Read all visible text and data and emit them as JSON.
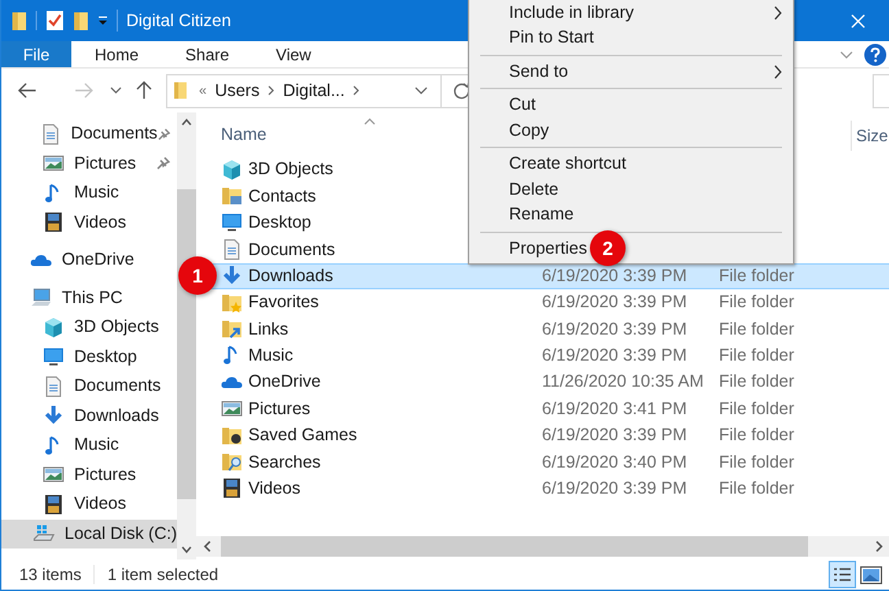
{
  "window": {
    "title": "Digital Citizen"
  },
  "ribbon_tabs": [
    {
      "label": "File",
      "selected": true
    },
    {
      "label": "Home",
      "selected": false
    },
    {
      "label": "Share",
      "selected": false
    },
    {
      "label": "View",
      "selected": false
    }
  ],
  "address_bar": {
    "overflow": "«",
    "segments": [
      "Users",
      "Digital..."
    ]
  },
  "navigation_pane": {
    "quick_access_items": [
      {
        "label": "Documents",
        "kind": "documents",
        "pinned": true,
        "selected": false
      },
      {
        "label": "Pictures",
        "kind": "pictures",
        "pinned": true,
        "selected": false
      },
      {
        "label": "Music",
        "kind": "music",
        "pinned": false,
        "selected": false
      },
      {
        "label": "Videos",
        "kind": "videos",
        "pinned": false,
        "selected": false
      }
    ],
    "items": [
      {
        "label": "OneDrive",
        "kind": "cloud",
        "selected": false
      },
      {
        "label": "This PC",
        "kind": "pc",
        "selected": false,
        "children": [
          {
            "label": "3D Objects",
            "kind": "cube",
            "selected": false
          },
          {
            "label": "Desktop",
            "kind": "desktop",
            "selected": false
          },
          {
            "label": "Documents",
            "kind": "documents",
            "selected": false
          },
          {
            "label": "Downloads",
            "kind": "download",
            "selected": false
          },
          {
            "label": "Music",
            "kind": "music",
            "selected": false
          },
          {
            "label": "Pictures",
            "kind": "pictures",
            "selected": false
          },
          {
            "label": "Videos",
            "kind": "videos",
            "selected": false
          },
          {
            "label": "Local Disk (C:)",
            "kind": "disk",
            "selected": true
          }
        ]
      }
    ]
  },
  "file_list": {
    "columns": [
      "Name",
      "Size"
    ],
    "rows": [
      {
        "name": "3D Objects",
        "kind": "cube",
        "selected": false
      },
      {
        "name": "Contacts",
        "kind": "contacts",
        "selected": false
      },
      {
        "name": "Desktop",
        "kind": "desktop",
        "selected": false
      },
      {
        "name": "Documents",
        "kind": "documents",
        "selected": false
      },
      {
        "name": "Downloads",
        "kind": "download",
        "date": "6/19/2020 3:39 PM",
        "type": "File folder",
        "selected": true
      },
      {
        "name": "Favorites",
        "kind": "star",
        "date": "6/19/2020 3:39 PM",
        "type": "File folder",
        "selected": false
      },
      {
        "name": "Links",
        "kind": "link",
        "date": "6/19/2020 3:39 PM",
        "type": "File folder",
        "selected": false
      },
      {
        "name": "Music",
        "kind": "music",
        "date": "6/19/2020 3:39 PM",
        "type": "File folder",
        "selected": false
      },
      {
        "name": "OneDrive",
        "kind": "cloud",
        "date": "11/26/2020 10:35 AM",
        "type": "File folder",
        "selected": false
      },
      {
        "name": "Pictures",
        "kind": "pictures",
        "date": "6/19/2020 3:41 PM",
        "type": "File folder",
        "selected": false
      },
      {
        "name": "Saved Games",
        "kind": "games",
        "date": "6/19/2020 3:39 PM",
        "type": "File folder",
        "selected": false
      },
      {
        "name": "Searches",
        "kind": "search",
        "date": "6/19/2020 3:40 PM",
        "type": "File folder",
        "selected": false
      },
      {
        "name": "Videos",
        "kind": "videos",
        "date": "6/19/2020 3:39 PM",
        "type": "File folder",
        "selected": false
      }
    ]
  },
  "context_menu": [
    {
      "kind": "item",
      "label": "Include in library",
      "submenu": true
    },
    {
      "kind": "item",
      "label": "Pin to Start",
      "submenu": false
    },
    {
      "kind": "separator"
    },
    {
      "kind": "item",
      "label": "Send to",
      "submenu": true
    },
    {
      "kind": "separator"
    },
    {
      "kind": "item",
      "label": "Cut",
      "submenu": false
    },
    {
      "kind": "item",
      "label": "Copy",
      "submenu": false
    },
    {
      "kind": "separator"
    },
    {
      "kind": "item",
      "label": "Create shortcut",
      "submenu": false
    },
    {
      "kind": "item",
      "label": "Delete",
      "submenu": false
    },
    {
      "kind": "item",
      "label": "Rename",
      "submenu": false
    },
    {
      "kind": "separator"
    },
    {
      "kind": "item",
      "label": "Properties",
      "submenu": false
    }
  ],
  "step_badges": [
    "1",
    "2"
  ],
  "status_bar": {
    "item_count": "13 items",
    "selection": "1 item selected"
  }
}
